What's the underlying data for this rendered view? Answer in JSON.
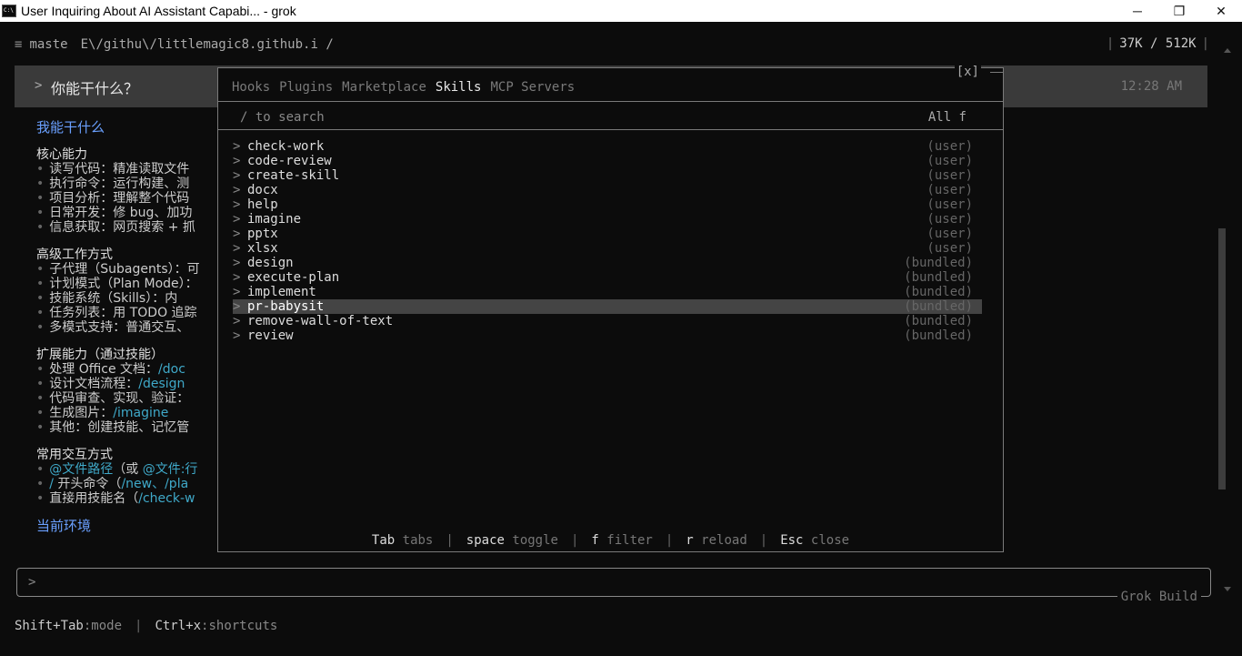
{
  "window": {
    "title": "User Inquiring About AI Assistant Capabi... - grok",
    "minimize": "─",
    "restore": "❐",
    "close": "✕"
  },
  "status": {
    "menu": "≡",
    "branch": "maste",
    "path": "E\\/githu\\/littlemagic8.github.i /",
    "tokens": "37K / 512K"
  },
  "message": {
    "text": "你能干什么？",
    "time": "12:28 AM"
  },
  "content": {
    "heading": "我能干什么",
    "sections": [
      {
        "title": "核心能力",
        "items": [
          {
            "t": "读写代码：精准读取文件"
          },
          {
            "t": "执行命令：运行构建、测"
          },
          {
            "t": "项目分析：理解整个代码"
          },
          {
            "t": "日常开发：修 bug、加功"
          },
          {
            "t": "信息获取：网页搜索 + 抓"
          }
        ]
      },
      {
        "title": "高级工作方式",
        "items": [
          {
            "t": "子代理（Subagents）：可"
          },
          {
            "t": "计划模式（Plan Mode）："
          },
          {
            "t": "技能系统（Skills）：内"
          },
          {
            "t": "任务列表：用 TODO 追踪"
          },
          {
            "t": "多模式支持：普通交互、"
          }
        ]
      },
      {
        "title": "扩展能力（通过技能）",
        "items": [
          {
            "t": "处理 Office 文档：",
            "c": "/doc"
          },
          {
            "t": "设计文档流程：",
            "c": "/design"
          },
          {
            "t": "代码审查、实现、验证："
          },
          {
            "t": "生成图片：",
            "c": "/imagine"
          },
          {
            "t": "其他：创建技能、记忆管"
          }
        ]
      },
      {
        "title": "常用交互方式",
        "items": [
          {
            "t": "",
            "c": "@文件路径",
            "t2": "（或 ",
            "c2": "@文件:行"
          },
          {
            "t": "",
            "c": "/",
            "t2": " 开头命令（",
            "c2": "/new、/pla"
          },
          {
            "t": "直接用技能名（",
            "c": "/check-w"
          }
        ]
      }
    ],
    "env_heading": "当前环境"
  },
  "modal": {
    "close": "[x]",
    "tabs": [
      "Hooks",
      "Plugins",
      "Marketplace",
      "Skills",
      "MCP Servers"
    ],
    "active_tab": 3,
    "search_placeholder": "/ to search",
    "filter": "All f",
    "skills": [
      {
        "name": "check-work",
        "src": "(user)"
      },
      {
        "name": "code-review",
        "src": "(user)"
      },
      {
        "name": "create-skill",
        "src": "(user)"
      },
      {
        "name": "docx",
        "src": "(user)"
      },
      {
        "name": "help",
        "src": "(user)"
      },
      {
        "name": "imagine",
        "src": "(user)"
      },
      {
        "name": "pptx",
        "src": "(user)"
      },
      {
        "name": "xlsx",
        "src": "(user)"
      },
      {
        "name": "design",
        "src": "(bundled)"
      },
      {
        "name": "execute-plan",
        "src": "(bundled)"
      },
      {
        "name": "implement",
        "src": "(bundled)"
      },
      {
        "name": "pr-babysit",
        "src": "(bundled)",
        "selected": true
      },
      {
        "name": "remove-wall-of-text",
        "src": "(bundled)"
      },
      {
        "name": "review",
        "src": "(bundled)"
      }
    ],
    "footer": [
      {
        "key": "Tab",
        "desc": "tabs"
      },
      {
        "key": "space",
        "desc": "toggle"
      },
      {
        "key": "f",
        "desc": "filter"
      },
      {
        "key": "r",
        "desc": "reload"
      },
      {
        "key": "Esc",
        "desc": "close"
      }
    ]
  },
  "input": {
    "prompt": ">",
    "label": "Grok Build"
  },
  "hints": {
    "mode_key": "Shift+Tab",
    "mode_desc": ":mode",
    "short_key": "Ctrl+x",
    "short_desc": ":shortcuts"
  }
}
